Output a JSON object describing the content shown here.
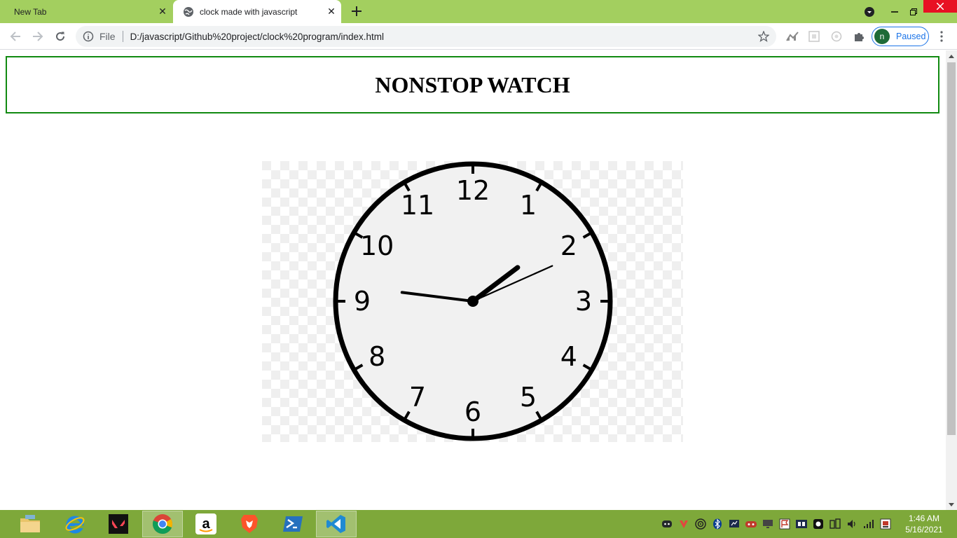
{
  "browser": {
    "tabs": [
      {
        "title": "New Tab",
        "active": false
      },
      {
        "title": "clock made with javascript",
        "active": true
      }
    ],
    "omnibox": {
      "scheme_label": "File",
      "url": "D:/javascript/Github%20project/clock%20program/index.html"
    },
    "profile": {
      "initial": "n",
      "status": "Paused"
    },
    "accent_color": "#a3cf5f"
  },
  "page": {
    "title": "NONSTOP WATCH",
    "clock": {
      "numbers": [
        "12",
        "1",
        "2",
        "3",
        "4",
        "5",
        "6",
        "7",
        "8",
        "9",
        "10",
        "11"
      ],
      "time_shown": {
        "hour": 1,
        "minute": 46,
        "second": 11
      }
    }
  },
  "taskbar": {
    "apps": [
      "file-explorer",
      "internet-explorer",
      "valorant",
      "google-chrome",
      "amazon",
      "brave",
      "powershell",
      "visual-studio-code"
    ],
    "active_app": "google-chrome",
    "time": "1:46 AM",
    "date": "5/16/2021"
  }
}
